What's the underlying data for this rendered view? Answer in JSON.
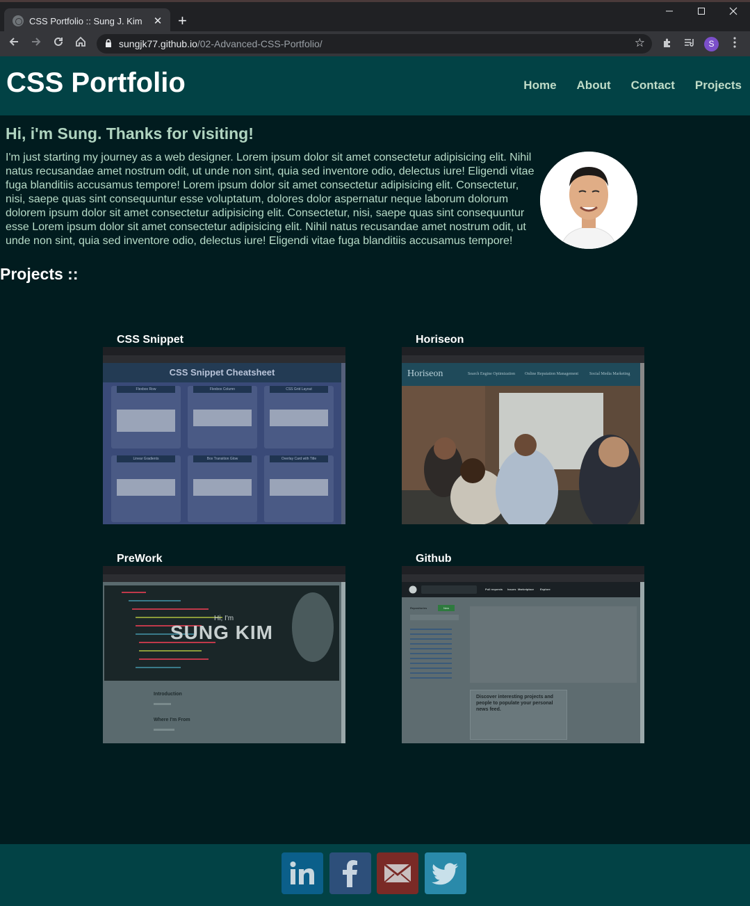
{
  "browser": {
    "tab_title": "CSS Portfolio :: Sung J. Kim",
    "tab_close": "✕",
    "new_tab": "+",
    "url_host": "sungjk77.github.io",
    "url_path": "/02-Advanced-CSS-Portfolio/",
    "profile_initial": "S"
  },
  "header": {
    "title": "CSS Portfolio",
    "nav": [
      "Home",
      "About",
      "Contact",
      "Projects"
    ]
  },
  "about": {
    "greeting": "Hi, i'm Sung. Thanks for visiting!",
    "intro": "I'm just starting my journey as a web designer. Lorem ipsum dolor sit amet consectetur adipisicing elit. Nihil natus recusandae amet nostrum odit, ut unde non sint, quia sed inventore odio, delectus iure! Eligendi vitae fuga blanditiis accusamus tempore! Lorem ipsum dolor sit amet consectetur adipisicing elit. Consectetur, nisi, saepe quas sint consequuntur esse voluptatum, dolores dolor aspernatur neque laborum dolorum dolorem ipsum dolor sit amet consectetur adipisicing elit. Consectetur, nisi, saepe quas sint consequuntur esse Lorem ipsum dolor sit amet consectetur adipisicing elit. Nihil natus recusandae amet nostrum odit, ut unde non sint, quia sed inventore odio, delectus iure! Eligendi vitae fuga blanditiis accusamus tempore!"
  },
  "projects": {
    "heading": "Projects ::",
    "items": [
      {
        "title": "CSS Snippet",
        "thumb": {
          "heading": "CSS Snippet Cheatsheet",
          "cards": [
            "Flexbox Row",
            "Flexbox Column",
            "CSS Grid Layout",
            "Linear Gradients",
            "Box Transition Glow",
            "Overlay Card with Title"
          ]
        }
      },
      {
        "title": "Horiseon",
        "thumb": {
          "logo": "Horiseon",
          "links": [
            "Search Engine Optimization",
            "Online Reputation Management",
            "Social Media Marketing"
          ]
        }
      },
      {
        "title": "PreWork",
        "thumb": {
          "hi": "Hi, I'm",
          "name": "SUNG KIM",
          "sections": [
            "Introduction",
            "Where I'm From"
          ]
        }
      },
      {
        "title": "Github",
        "thumb": {
          "side_title": "Repositories",
          "new_label": "New",
          "menu": [
            "Pull requests",
            "Issues",
            "Marketplace",
            "Explore"
          ],
          "card_title": "Discover interesting projects and people to populate your personal news feed."
        }
      }
    ]
  },
  "footer": {
    "social": [
      "linkedin-icon",
      "facebook-icon",
      "email-icon",
      "twitter-icon"
    ]
  }
}
